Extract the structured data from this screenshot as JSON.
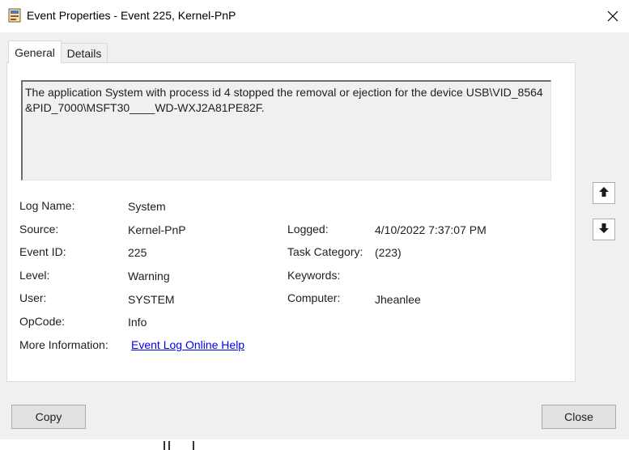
{
  "window": {
    "title": "Event Properties - Event 225, Kernel-PnP",
    "icon": "event-viewer-icon",
    "close_icon": "close-icon"
  },
  "tabs": [
    {
      "label": "General",
      "selected": true
    },
    {
      "label": "Details",
      "selected": false
    }
  ],
  "description": "The application System with process id 4 stopped the removal or ejection for the device USB\\VID_8564&PID_7000\\MSFT30____WD-WXJ2A81PE82F.",
  "fields": {
    "log_name": {
      "label": "Log Name:",
      "value": "System"
    },
    "source": {
      "label": "Source:",
      "value": "Kernel-PnP"
    },
    "event_id": {
      "label": "Event ID:",
      "value": "225"
    },
    "level": {
      "label": "Level:",
      "value": "Warning"
    },
    "user": {
      "label": "User:",
      "value": "SYSTEM"
    },
    "opcode": {
      "label": "OpCode:",
      "value": "Info"
    },
    "more_info": {
      "label": "More Information:",
      "value": "Event Log Online Help"
    },
    "logged": {
      "label": "Logged:",
      "value": "4/10/2022 7:37:07 PM"
    },
    "task_category": {
      "label": "Task Category:",
      "value": "(223)"
    },
    "keywords": {
      "label": "Keywords:",
      "value": ""
    },
    "computer": {
      "label": "Computer:",
      "value": "Jheanlee"
    }
  },
  "nav": {
    "up_icon": "arrow-up-icon",
    "down_icon": "arrow-down-icon"
  },
  "buttons": {
    "copy": "Copy",
    "close": "Close"
  },
  "colors": {
    "link": "#0000ee",
    "background": "#f0f0f0",
    "panel": "#ffffff"
  }
}
